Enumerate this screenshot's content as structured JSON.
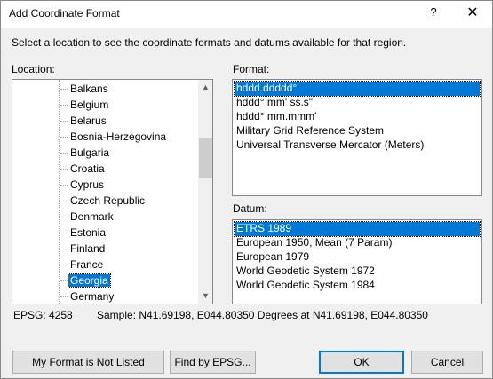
{
  "window": {
    "title": "Add Coordinate Format",
    "help_glyph": "?",
    "close_glyph": "✕"
  },
  "instructions": "Select a location to see the coordinate formats and datums available for that region.",
  "location": {
    "label": "Location:",
    "items": [
      "Balkans",
      "Belgium",
      "Belarus",
      "Bosnia-Herzegovina",
      "Bulgaria",
      "Croatia",
      "Cyprus",
      "Czech Republic",
      "Denmark",
      "Estonia",
      "Finland",
      "France",
      "Georgia",
      "Germany"
    ],
    "selected": "Georgia",
    "scroll_up_glyph": "▲",
    "scroll_down_glyph": "▼"
  },
  "format": {
    "label": "Format:",
    "items": [
      "hddd.ddddd°",
      "hddd° mm' ss.s\"",
      "hddd° mm.mmm'",
      "Military Grid Reference System",
      "Universal Transverse Mercator (Meters)"
    ],
    "selected": "hddd.ddddd°"
  },
  "datum": {
    "label": "Datum:",
    "items": [
      "ETRS 1989",
      "European 1950, Mean (7 Param)",
      "European 1979",
      "World Geodetic System 1972",
      "World Geodetic System 1984"
    ],
    "selected": "ETRS 1989"
  },
  "status": {
    "epsg": "EPSG: 4258",
    "sample": "Sample: N41.69198, E044.80350 Degrees at N41.69198, E044.80350"
  },
  "buttons": {
    "not_listed": "My Format is Not Listed",
    "find_epsg": "Find by EPSG...",
    "ok": "OK",
    "cancel": "Cancel"
  },
  "colors": {
    "selection": "#0078d7",
    "dialog_bg": "#f0f0f0"
  }
}
